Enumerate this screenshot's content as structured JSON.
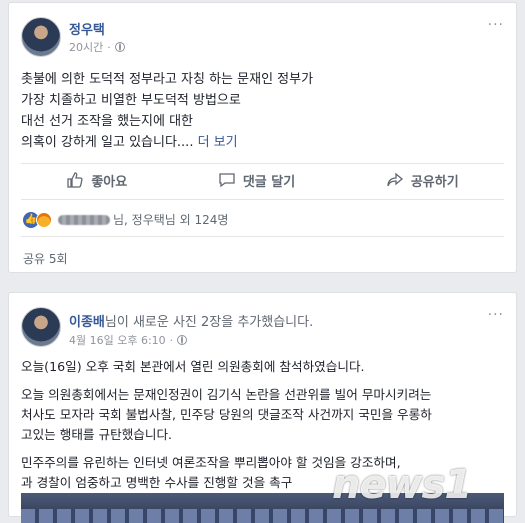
{
  "post1": {
    "author": "정우택",
    "time": "20시간",
    "body_lines": [
      "촛불에 의한 도덕적 정부라고 자칭 하는 문재인 정부가",
      "가장 치졸하고 비열한 부도덕적 방법으로",
      "대선 선거 조작을 했는지에 대한",
      "의혹이 강하게 일고 있습니다...."
    ],
    "see_more": "더 보기",
    "more_icon": "···",
    "actions": {
      "like": "좋아요",
      "comment": "댓글 달기",
      "share": "공유하기"
    },
    "reactions_text": "님, 정우택님 외 124명",
    "shares_text": "공유 5회"
  },
  "post2": {
    "author": "이종배",
    "header_suffix": "님이 새로운 사진 2장을 추가했습니다.",
    "time": "4월 16일 오후 6:10",
    "para1": "오늘(16일) 오후 국회 본관에서 열린 의원총회에 참석하였습니다.",
    "para2_lines": [
      "오늘 의원총회에서는 문재인정권이 김기식 논란을 선관위를 빌어 무마시키려는",
      "처사도 모자라 국회 불법사찰, 민주당 당원의 댓글조작 사건까지 국민을 우롱하",
      "고있는 행태를 규탄했습니다."
    ],
    "para3_lines": [
      "민주주의를 유린하는 인터넷 여론조작을 뿌리뽑아야 할 것임을 강조하며,",
      "과 경찰이 엄중하고 명백한 수사를 진행할 것을 촉구"
    ],
    "more_icon": "···"
  },
  "watermark": "news1"
}
